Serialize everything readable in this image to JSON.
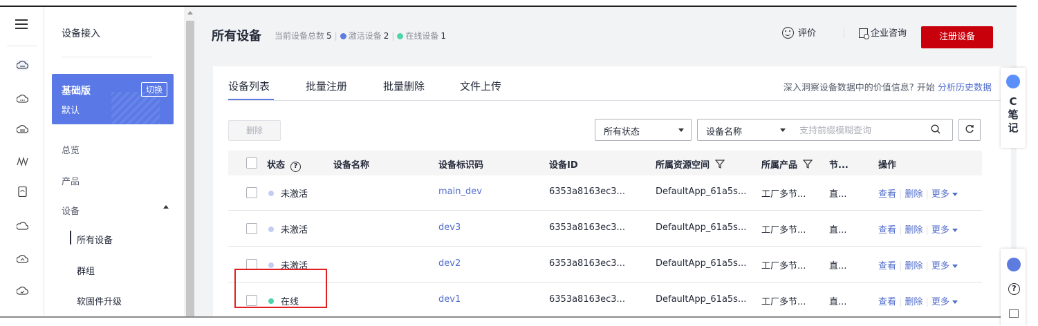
{
  "rail": {
    "icons": [
      "menu-icon",
      "cloud-icon-1",
      "cloud-icon-2",
      "cloud-icon-3",
      "waves-icon",
      "device-icon",
      "cloud-icon-4",
      "cloud-up-icon",
      "cloud-check-icon"
    ]
  },
  "sidebar": {
    "title": "设备接入",
    "edition": {
      "name": "基础版",
      "sub": "默认",
      "switch_label": "切换"
    },
    "items": [
      {
        "label": "总览"
      },
      {
        "label": "产品"
      },
      {
        "label": "设备"
      },
      {
        "label": "所有设备"
      },
      {
        "label": "群组"
      },
      {
        "label": "软固件升级"
      }
    ]
  },
  "header": {
    "title": "所有设备",
    "stats": {
      "total_label": "当前设备总数",
      "total": "5",
      "activated_label": "激活设备",
      "activated": "2",
      "online_label": "在线设备",
      "online": "1"
    },
    "rate_label": "评价",
    "consult_label": "企业咨询",
    "register_label": "注册设备"
  },
  "tabs": [
    "设备列表",
    "批量注册",
    "批量删除",
    "文件上传"
  ],
  "insight": {
    "text": "深入洞察设备数据中的价值信息? 开始",
    "link": "分析历史数据"
  },
  "toolbar": {
    "delete_label": "删除",
    "status_select": "所有状态",
    "field_select": "设备名称",
    "search_placeholder": "支持前缀模糊查询"
  },
  "table": {
    "headers": {
      "status": "状态",
      "name": "设备名称",
      "identifier": "设备标识码",
      "id": "设备ID",
      "space": "所属资源空间",
      "product": "所属产品",
      "node": "节...",
      "ops": "操作"
    },
    "rows": [
      {
        "status": "未激活",
        "name": "",
        "identifier": "main_dev",
        "id": "6353a8163ec3...",
        "space": "DefaultApp_61a5s...",
        "product": "工厂多节...",
        "node": "直...",
        "view": "查看",
        "delete": "删除",
        "more": "更多"
      },
      {
        "status": "未激活",
        "name": "",
        "identifier": "dev3",
        "id": "6353a8163ec3...",
        "space": "DefaultApp_61a5s...",
        "product": "工厂多节...",
        "node": "直...",
        "view": "查看",
        "delete": "删除",
        "more": "更多"
      },
      {
        "status": "未激活",
        "name": "",
        "identifier": "dev2",
        "id": "6353a8163ec3...",
        "space": "DefaultApp_61a5s...",
        "product": "工厂多节...",
        "node": "直...",
        "view": "查看",
        "delete": "删除",
        "more": "更多"
      },
      {
        "status": "在线",
        "name": "",
        "identifier": "dev1",
        "id": "6353a8163ec3...",
        "space": "DefaultApp_61a5s...",
        "product": "工厂多节...",
        "node": "直...",
        "view": "查看",
        "delete": "删除",
        "more": "更多"
      }
    ]
  },
  "float": {
    "note_c": "C",
    "note_1": "笔",
    "note_2": "记",
    "help": "?"
  },
  "colors": {
    "activated_dot": "#5e7ce0",
    "online_dot": "#50d4ab",
    "inactive_dot": "#c2cdf2",
    "brand_red": "#c7000b",
    "edition_blue": "#5a79e6",
    "link": "#526ecc"
  }
}
